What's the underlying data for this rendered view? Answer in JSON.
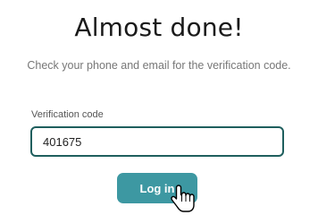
{
  "heading": "Almost done!",
  "instructions": "Check your phone and email for the verification code.",
  "verification": {
    "label": "Verification code",
    "value": "401675",
    "focused": true,
    "border_color": "#1f5f5e"
  },
  "login_button": {
    "label": "Log in",
    "color": "#3d98a2"
  },
  "cursor": {
    "icon": "hand-pointer-icon"
  }
}
